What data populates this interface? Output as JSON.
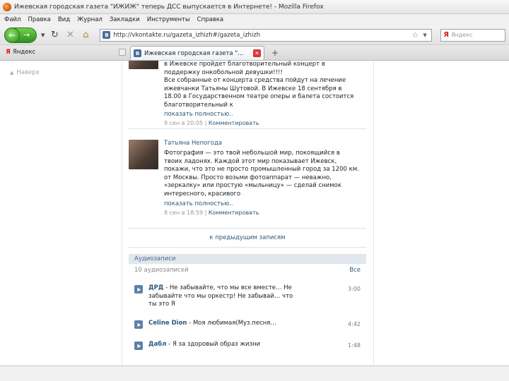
{
  "window": {
    "title": "Ижевская городская газета \"ИЖИЖ\" теперь ДСС выпускается в Интернете! - Mozilla Firefox"
  },
  "menu": {
    "items": [
      "Файл",
      "Правка",
      "Вид",
      "Журнал",
      "Закладки",
      "Инструменты",
      "Справка"
    ]
  },
  "nav": {
    "url": "http://vkontakte.ru/gazeta_izhizh#/gazeta_izhizh",
    "search_placeholder": "Яндекс",
    "yandex_letter": "Я"
  },
  "bookmarks": {
    "yandex_label": "Яндекс"
  },
  "tab": {
    "label": "Ижевская городская газета \"..."
  },
  "sidebar": {
    "back_label": "Наверх"
  },
  "posts": [
    {
      "author": "",
      "lines": [
        "в Ижевске пройдет благотворительный концерт в",
        "поддержку онкобольной девушки!!!!",
        "Все собранные от концерта средства пойдут на лечение",
        "ижевчанки Татьяны Шутовой. В Ижевске 18 сентября в",
        "18.00 в Государственном театре оперы и балета состоится",
        "благотворительный к"
      ],
      "more": "показать полностью..",
      "date": "9 сен в 20:05",
      "comment": "Комментировать"
    },
    {
      "author": "Татьяна Непогода",
      "lines": [
        "Фотография — это твой небольшой мир, покоящийся в",
        "твоих ладонях. Каждой этот мир показывает Ижевск,",
        "покажи, что это не просто промышленный город за 1200 км.",
        "от Москвы. Просто возьми фотоаппарат — неважно,",
        "«зеркалку» или простую «мыльницу» — сделай снимок",
        "интересного, красивого"
      ],
      "more": "показать полностью..",
      "date": "8 сен в 18:59",
      "comment": "Комментировать"
    }
  ],
  "prev_posts": "к предыдущим записям",
  "audio": {
    "title": "Аудиозаписи",
    "count": "10 аудиозаписей",
    "all": "Все",
    "tracks": [
      {
        "artist": "ДРД",
        "title": " - Не забывайте, что мы все вместе… Не",
        "title2": "забывайте что мы оркестр! Не забывай… что",
        "title3": "ты это Я",
        "duration": "3:00"
      },
      {
        "artist": "Celine Dion",
        "title": " - Моя любимая(Муз.песня…",
        "title2": "",
        "title3": "",
        "duration": "4:42"
      },
      {
        "artist": "Дабл",
        "title": " - Я за здоровый образ жизни",
        "title2": "",
        "title3": "",
        "duration": "1:48"
      }
    ]
  }
}
